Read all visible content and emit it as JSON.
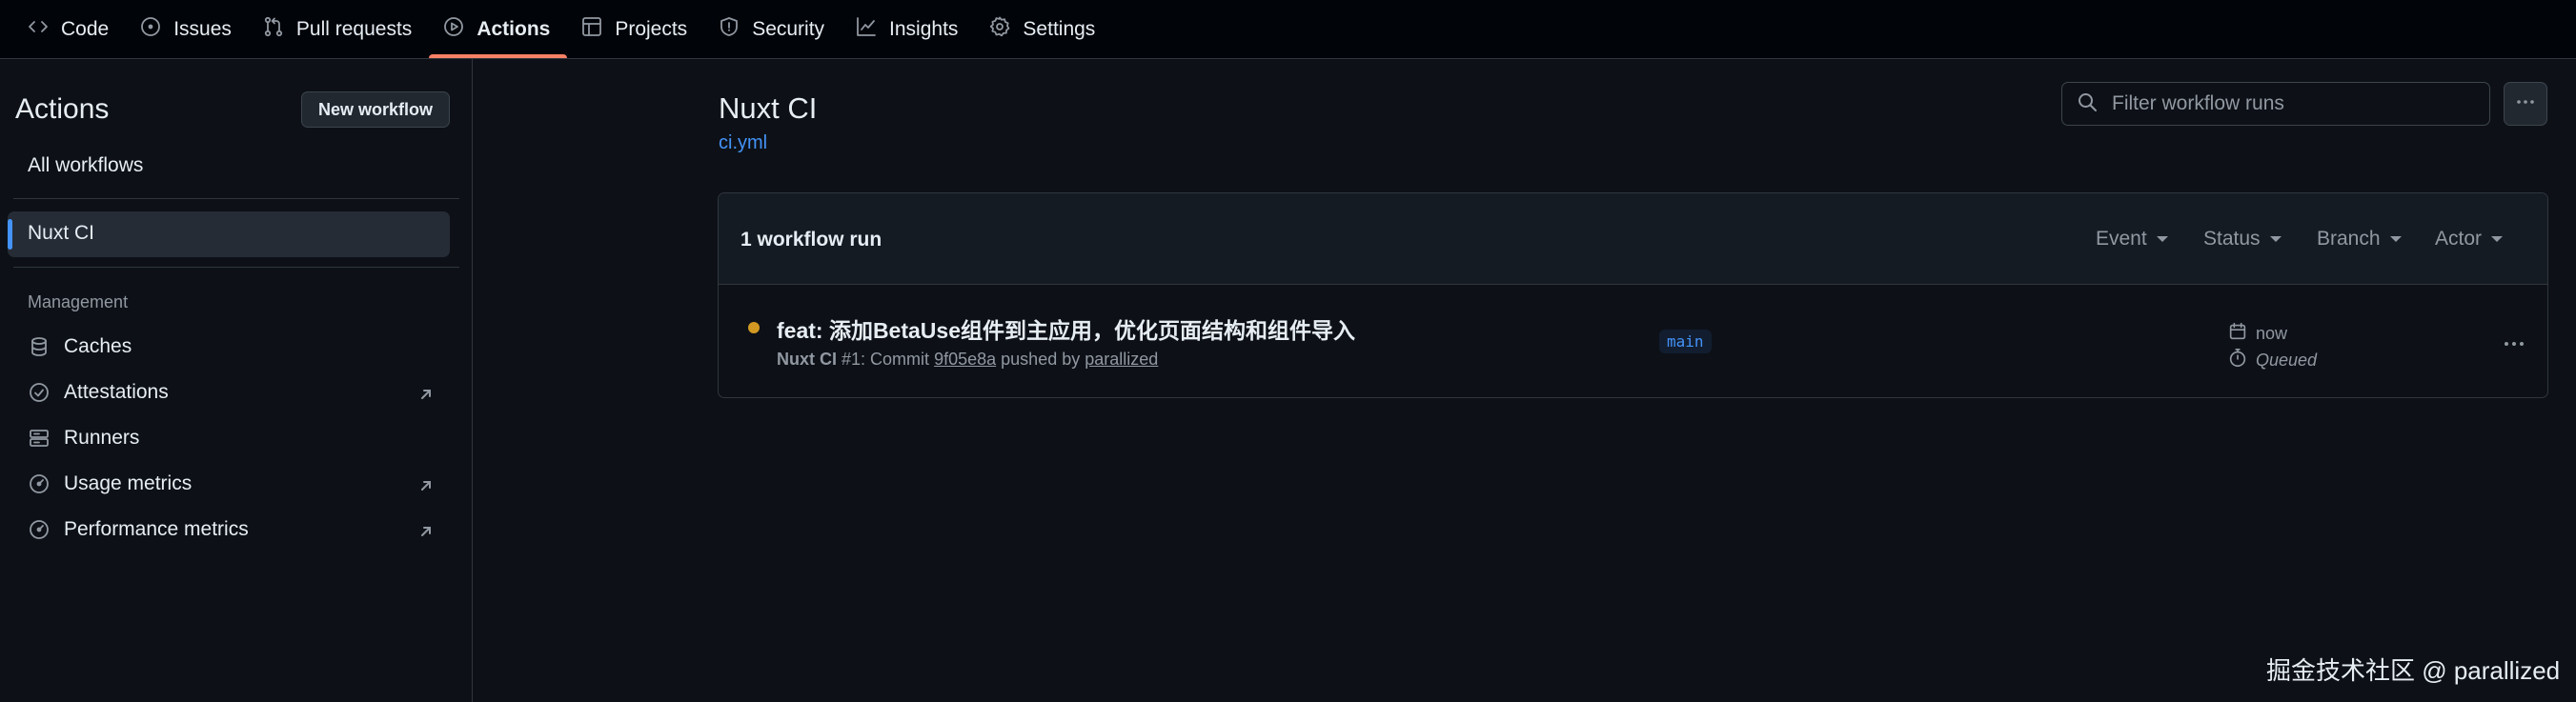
{
  "repo_nav": {
    "tabs": [
      {
        "label": "Code",
        "icon": "code-icon"
      },
      {
        "label": "Issues",
        "icon": "issue-opened-icon"
      },
      {
        "label": "Pull requests",
        "icon": "git-pull-request-icon"
      },
      {
        "label": "Actions",
        "icon": "play-icon",
        "active": true
      },
      {
        "label": "Projects",
        "icon": "table-icon"
      },
      {
        "label": "Security",
        "icon": "shield-icon"
      },
      {
        "label": "Insights",
        "icon": "graph-icon"
      },
      {
        "label": "Settings",
        "icon": "gear-icon"
      }
    ]
  },
  "sidebar": {
    "title": "Actions",
    "new_workflow_label": "New workflow",
    "all_workflows_label": "All workflows",
    "workflows": [
      {
        "label": "Nuxt CI",
        "selected": true
      }
    ],
    "management_heading": "Management",
    "management_items": [
      {
        "label": "Caches",
        "icon": "database-icon",
        "external": false
      },
      {
        "label": "Attestations",
        "icon": "verified-icon",
        "external": true
      },
      {
        "label": "Runners",
        "icon": "server-icon",
        "external": false
      },
      {
        "label": "Usage metrics",
        "icon": "meter-icon",
        "external": true
      },
      {
        "label": "Performance metrics",
        "icon": "meter-icon",
        "external": true
      }
    ]
  },
  "main": {
    "workflow_title": "Nuxt CI",
    "workflow_file": "ci.yml",
    "filter_placeholder": "Filter workflow runs",
    "runs_count_label": "1 workflow run",
    "filters": [
      "Event",
      "Status",
      "Branch",
      "Actor"
    ],
    "runs": [
      {
        "title": "feat: 添加BetaUse组件到主应用，优化页面结构和组件导入",
        "workflow": "Nuxt CI",
        "run_number": "#1",
        "meta_commit_prefix": ": Commit",
        "commit": "9f05e8a",
        "pushed_by_text": "pushed by",
        "actor": "parallized",
        "branch": "main",
        "when": "now",
        "status": "Queued",
        "status_color": "#d29922"
      }
    ]
  },
  "watermark": "掘金技术社区 @ parallized",
  "colors": {
    "accent": "#4493f8",
    "active_tab_underline": "#f78166",
    "queued": "#d29922",
    "background": "#0d1117"
  }
}
